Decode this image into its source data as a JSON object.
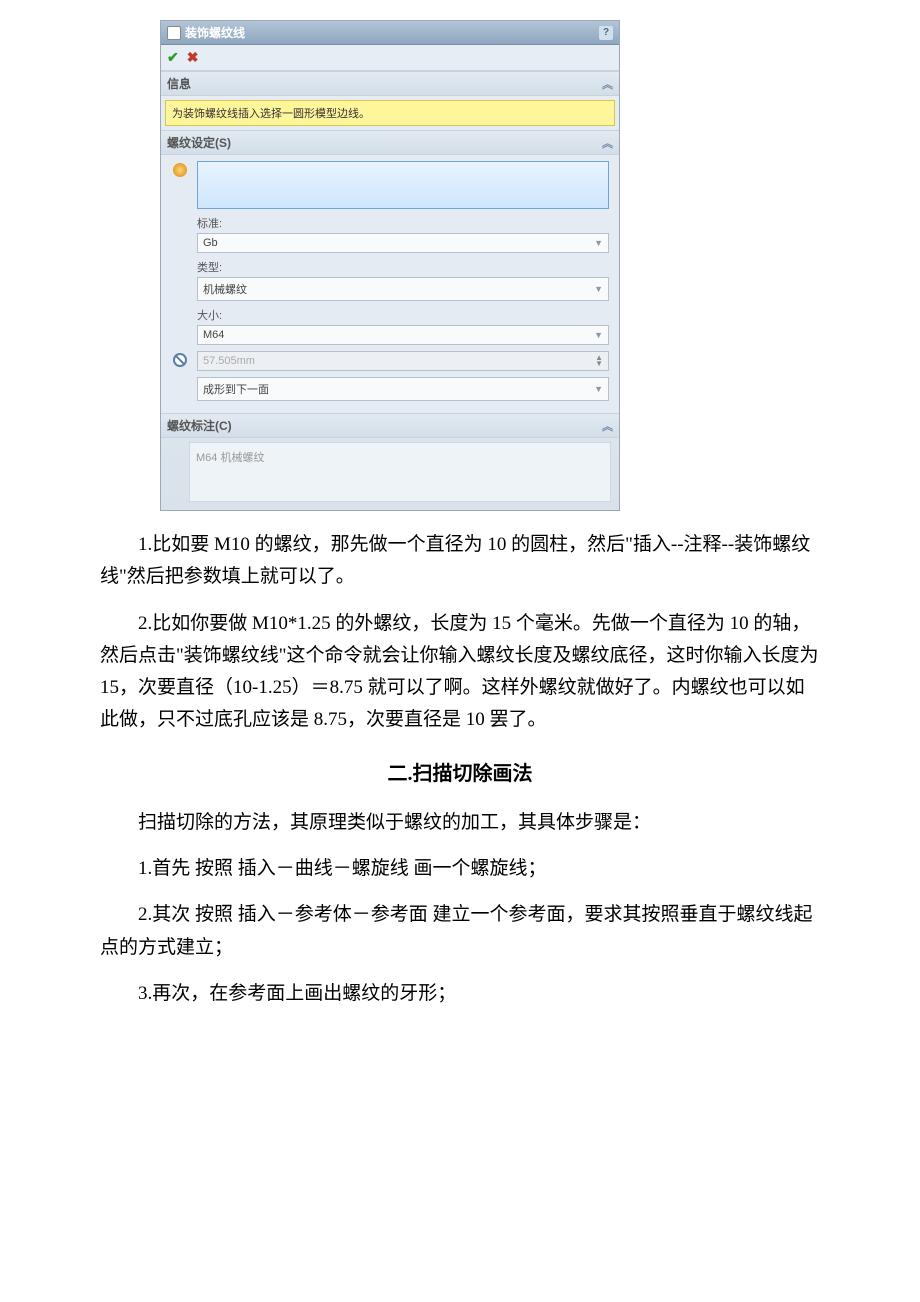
{
  "dialog": {
    "title": "装饰螺纹线",
    "help": "?",
    "info_header": "信息",
    "info_message": "为装饰螺纹线插入选择一圆形模型边线。",
    "settings_header": "螺纹设定(S)",
    "standard_label": "标准:",
    "standard_value": "Gb",
    "type_label": "类型:",
    "type_value": "机械螺纹",
    "size_label": "大小:",
    "size_value": "M64",
    "diameter_value": "57.505mm",
    "form_value": "成形到下一面",
    "callout_header": "螺纹标注(C)",
    "callout_value": "M64 机械螺纹"
  },
  "doc": {
    "para1_a": "1.比如要 M10 的螺纹，那先做一个直径为 10 的圆柱，然后\"插入--注释--装饰螺纹线\"然后把参数填上就可以了。",
    "para2": "2.比如你要做 M10*1.25 的外螺纹，长度为 15 个毫米。先做一个直径为 10 的轴，然后点击\"装饰螺纹线\"这个命令就会让你输入螺纹长度及螺纹底径，这时你输入长度为 15，次要直径（10-1.25）＝8.75 就可以了啊。这样外螺纹就做好了。内螺纹也可以如此做，只不过底孔应该是 8.75，次要直径是 10 罢了。",
    "heading2": "二.扫描切除画法",
    "para3": "扫描切除的方法，其原理类似于螺纹的加工，其具体步骤是：",
    "para4": "1.首先 按照 插入－曲线－螺旋线  画一个螺旋线；",
    "para5": "2.其次 按照 插入－参考体－参考面  建立一个参考面，要求其按照垂直于螺纹线起点的方式建立；",
    "para6": "3.再次，在参考面上画出螺纹的牙形；"
  }
}
